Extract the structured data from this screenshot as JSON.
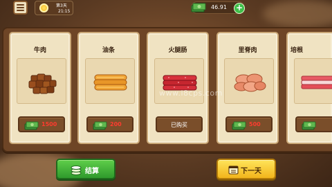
{
  "hud": {
    "day_label": "第3天",
    "time": "21:15",
    "money": "46.91"
  },
  "cards": [
    {
      "name": "牛肉",
      "food": "beef-cubes",
      "price": "1500",
      "bought": false
    },
    {
      "name": "油条",
      "food": "fried-dough-sticks",
      "price": "200",
      "bought": false
    },
    {
      "name": "火腿肠",
      "food": "ham-sausage",
      "price": "",
      "bought": true,
      "bought_label": "已购买"
    },
    {
      "name": "里脊肉",
      "food": "tenderloin",
      "price": "500",
      "bought": false
    },
    {
      "name": "培根",
      "food": "bacon",
      "price": "",
      "bought": false
    }
  ],
  "watermark": "www.i8cps.com",
  "buttons": {
    "settle": "结算",
    "next_day": "下一天"
  },
  "colors": {
    "panel": "#6e4526",
    "card": "#f0e3c2",
    "price_text": "#ff3b2f",
    "settle_green": "#3fa835",
    "next_yellow": "#f7c830"
  }
}
